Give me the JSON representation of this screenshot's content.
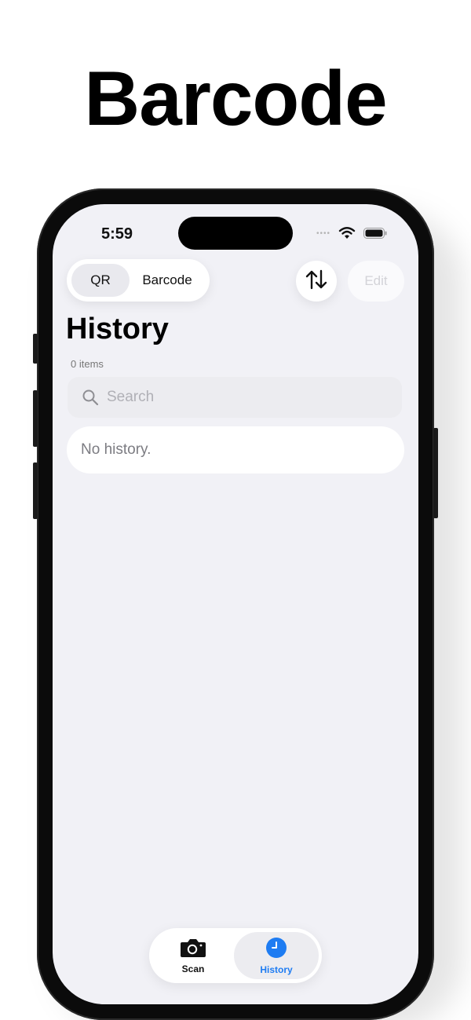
{
  "promo": {
    "title": "Barcode"
  },
  "status_bar": {
    "time": "5:59"
  },
  "mode_switch": {
    "options": [
      "QR",
      "Barcode"
    ],
    "selected": "QR"
  },
  "toolbar": {
    "edit_label": "Edit",
    "sort_icon": "sort-arrows-icon"
  },
  "history": {
    "title": "History",
    "count_text": "0 items",
    "search_placeholder": "Search",
    "empty_text": "No history."
  },
  "tabbar": {
    "tabs": [
      {
        "label": "Scan",
        "icon": "camera-icon"
      },
      {
        "label": "History",
        "icon": "clock-icon"
      }
    ],
    "active": "History"
  },
  "colors": {
    "accent": "#1e7cf2",
    "screen_bg": "#f1f1f6",
    "edit_disabled": "#d3d3d8"
  }
}
